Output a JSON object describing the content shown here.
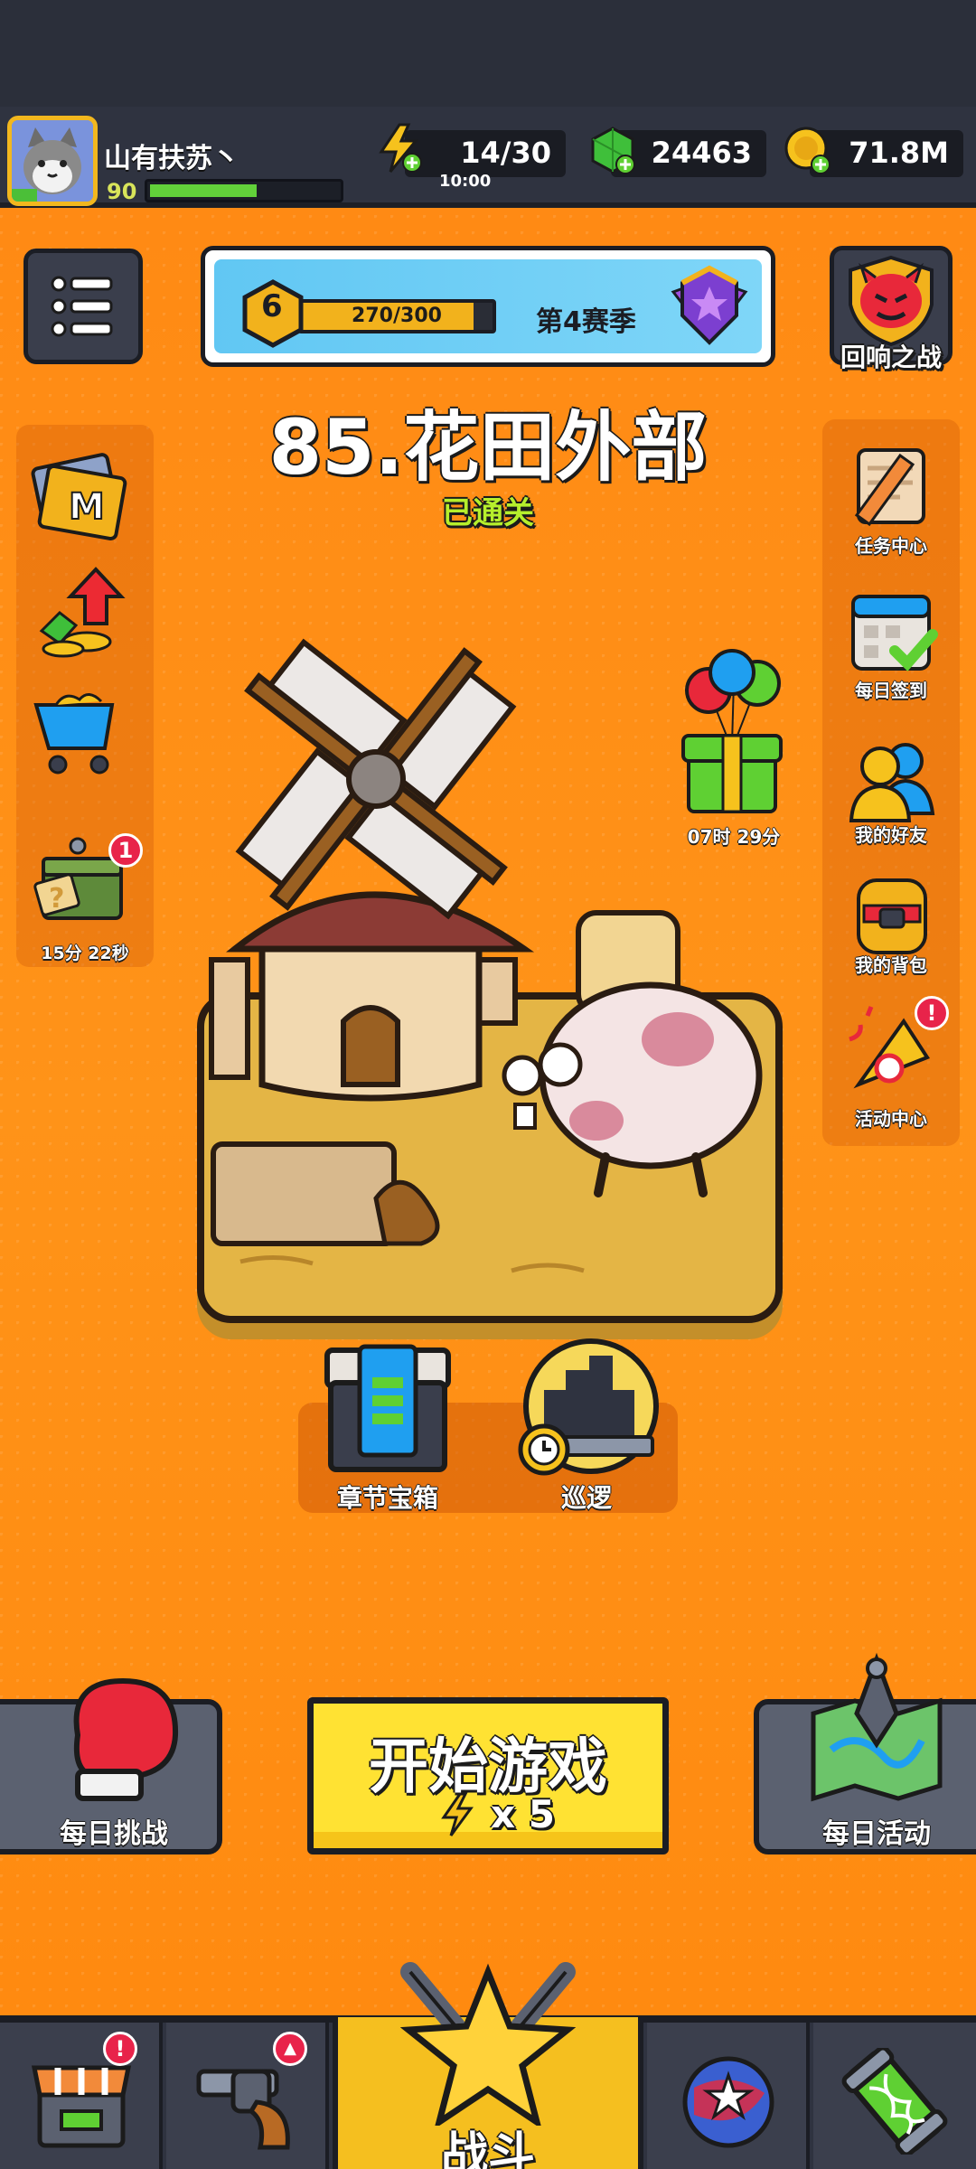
{
  "player": {
    "name": "山有扶苏丶",
    "level": "90",
    "xp_progress": 0.55
  },
  "resources": {
    "energy": {
      "value": "14/30",
      "timer": "10:00",
      "icon": "energy-bolt-icon"
    },
    "gems": {
      "value": "24463",
      "icon": "green-gem-icon"
    },
    "coins": {
      "value": "71.8M",
      "icon": "gold-coin-icon"
    }
  },
  "season": {
    "level": "6",
    "progress": "270/300",
    "progress_ratio": 0.9,
    "label": "第4赛季"
  },
  "echo_battle": {
    "label": "回响之战"
  },
  "stage": {
    "title": "85.花田外部",
    "status": "已通关"
  },
  "left_side": {
    "pass_icon": "m-pass-card-icon",
    "growth_icon": "growth-fund-icon",
    "shop_icon": "cart-icon",
    "supply": {
      "timer": "15分 22秒",
      "badge": "1"
    }
  },
  "gift": {
    "timer": "07时 29分"
  },
  "right_side": {
    "items": [
      {
        "label": "任务中心",
        "icon": "scroll-quest-icon"
      },
      {
        "label": "每日签到",
        "icon": "calendar-check-icon"
      },
      {
        "label": "我的好友",
        "icon": "friends-icon"
      },
      {
        "label": "我的背包",
        "icon": "backpack-icon"
      },
      {
        "label": "活动中心",
        "icon": "party-horn-icon",
        "badge": "!"
      }
    ]
  },
  "chapter": {
    "chest_label": "章节宝箱",
    "patrol_label": "巡逻"
  },
  "bottom": {
    "daily_challenge": "每日挑战",
    "start": {
      "label": "开始游戏",
      "cost": "x 5"
    },
    "daily_activity": "每日活动"
  },
  "nav": {
    "shop_badge": "!",
    "battle_label": "战斗",
    "colors": {
      "active": "#f5bf1f",
      "inactive": "#3b3f4d"
    }
  }
}
